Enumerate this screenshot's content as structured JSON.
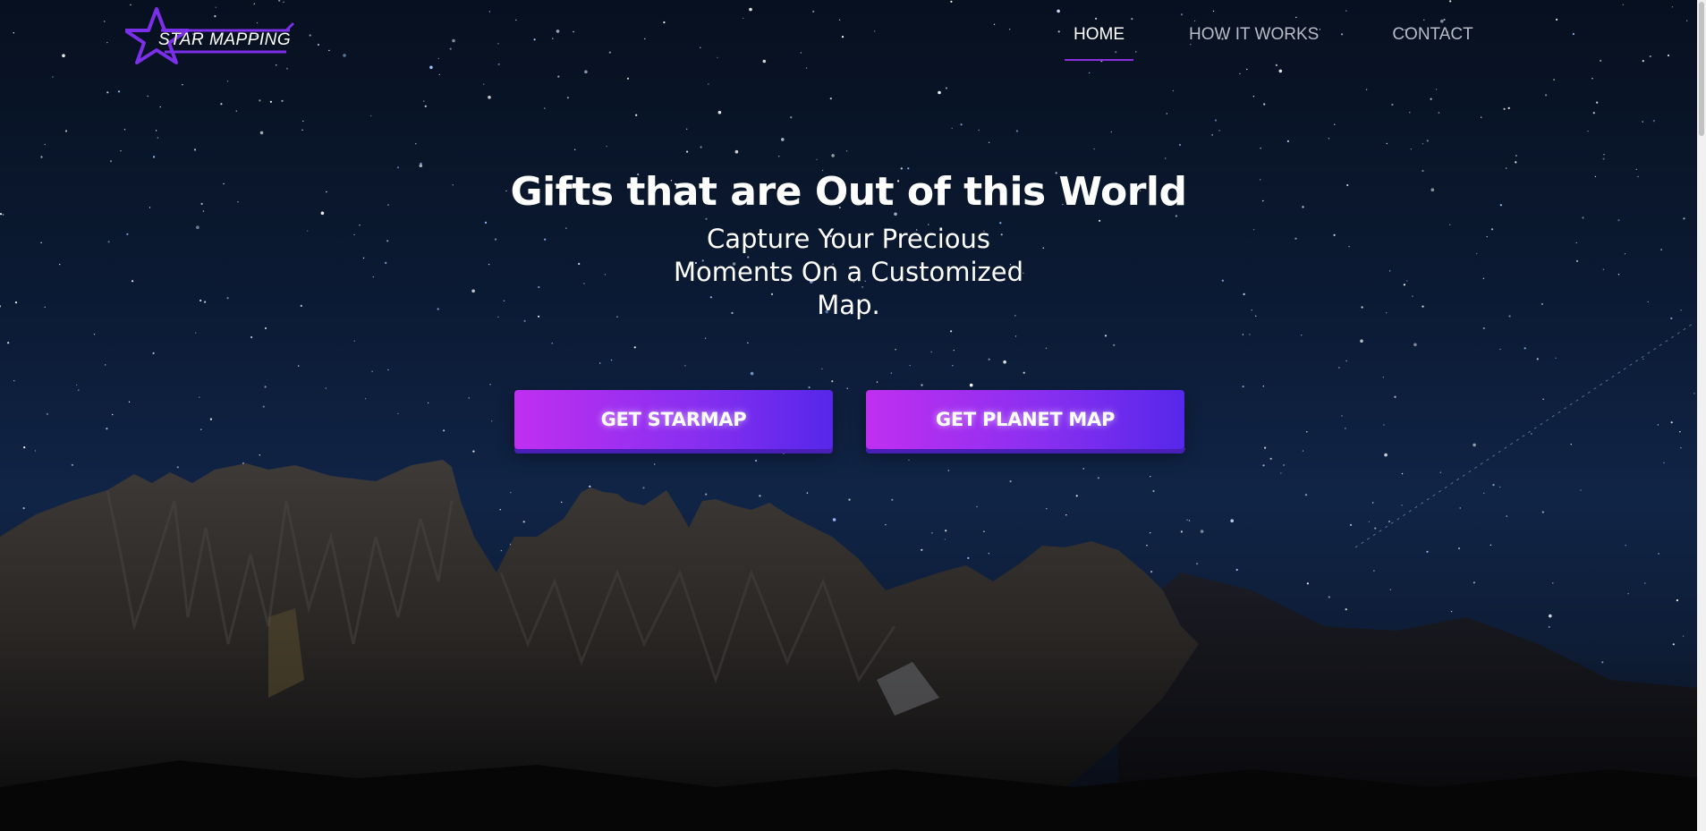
{
  "brand": {
    "name": "STAR MAPPING",
    "icon": "star-logo-icon",
    "accent_color": "#7b2fe8"
  },
  "nav": {
    "items": [
      {
        "label": "HOME",
        "active": true
      },
      {
        "label": "HOW IT WORKS",
        "active": false
      },
      {
        "label": "CONTACT",
        "active": false
      }
    ]
  },
  "hero": {
    "title": "Gifts that are Out of this World",
    "subtitle": "Capture Your Precious Moments On a Customized Map."
  },
  "buttons": {
    "starmap_label": "GET STARMAP",
    "planet_map_label": "GET PLANET MAP"
  },
  "colors": {
    "button_start": "#c02ff0",
    "button_end": "#5627ea",
    "nav_underline": "#8b2de0"
  }
}
